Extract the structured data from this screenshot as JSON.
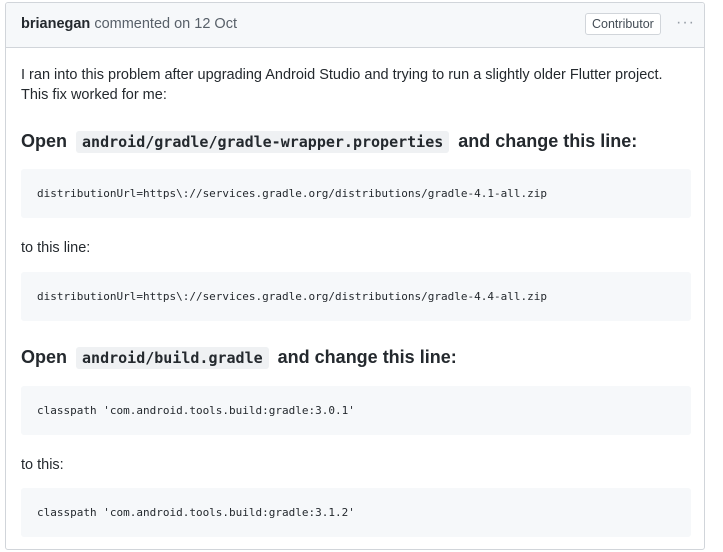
{
  "header": {
    "author": "brianegan",
    "action": "commented on 12 Oct",
    "badge": "Contributor",
    "menu_icon": "kebab-horizontal-icon"
  },
  "body": {
    "intro_line1": "I ran into this problem after upgrading Android Studio and trying to run a slightly older Flutter project.",
    "intro_line2": "This fix worked for me:",
    "section1": {
      "open_word": "Open",
      "path": "android/gradle/gradle-wrapper.properties",
      "suffix": "and change this line:",
      "code_before": "distributionUrl=https\\://services.gradle.org/distributions/gradle-4.1-all.zip",
      "to_text": "to this line:",
      "code_after": "distributionUrl=https\\://services.gradle.org/distributions/gradle-4.4-all.zip"
    },
    "section2": {
      "open_word": "Open",
      "path": "android/build.gradle",
      "suffix": "and change this line:",
      "code_before": "classpath 'com.android.tools.build:gradle:3.0.1'",
      "to_text": "to this:",
      "code_after": "classpath 'com.android.tools.build:gradle:3.1.2'"
    }
  }
}
